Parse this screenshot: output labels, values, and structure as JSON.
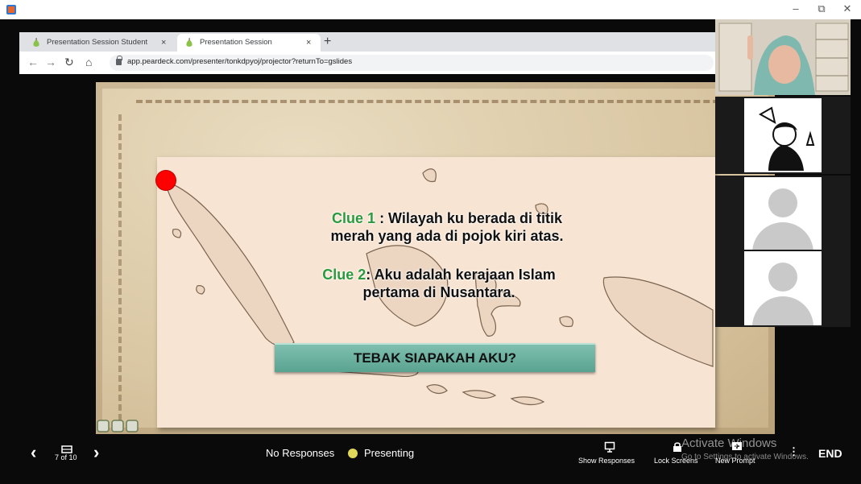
{
  "window": {
    "minimize": "–",
    "restore": "⧉",
    "close": "✕"
  },
  "browser": {
    "tabs": [
      {
        "label": "Presentation Session Student",
        "close": "×"
      },
      {
        "label": "Presentation Session",
        "close": "×"
      }
    ],
    "new_tab": "+",
    "nav": {
      "back": "←",
      "forward": "→",
      "reload": "↻",
      "home": "⌂"
    },
    "url": "app.peardeck.com/presenter/tonkdpyoj/projector?returnTo=gslides"
  },
  "slide": {
    "clue1_label": "Clue 1",
    "clue1_text": " : Wilayah ku berada di titik",
    "clue1_line2": "merah yang ada di pojok kiri atas.",
    "clue2_label": "Clue 2",
    "clue2_text": ": Aku adalah kerajaan Islam",
    "clue2_line2": "pertama di Nusantara.",
    "banner": "TEBAK SIAPAKAH AKU?"
  },
  "toolbar": {
    "prev": "‹",
    "next": "›",
    "slide_counter": "7 of 10",
    "responses_status": "No Responses",
    "presenting_label": "Presenting",
    "show_responses": "Show Responses",
    "lock_screens": "Lock Screens",
    "new_prompt": "New Prompt",
    "more": "⋮",
    "end": "END"
  },
  "watermark": {
    "line1": "Activate Windows",
    "line2": "Go to Settings to activate Windows."
  },
  "colors": {
    "clue_green": "#2b9a3e",
    "banner": "#6db09f",
    "red_marker": "#ff0000",
    "presenting_dot": "#e0d85a"
  }
}
